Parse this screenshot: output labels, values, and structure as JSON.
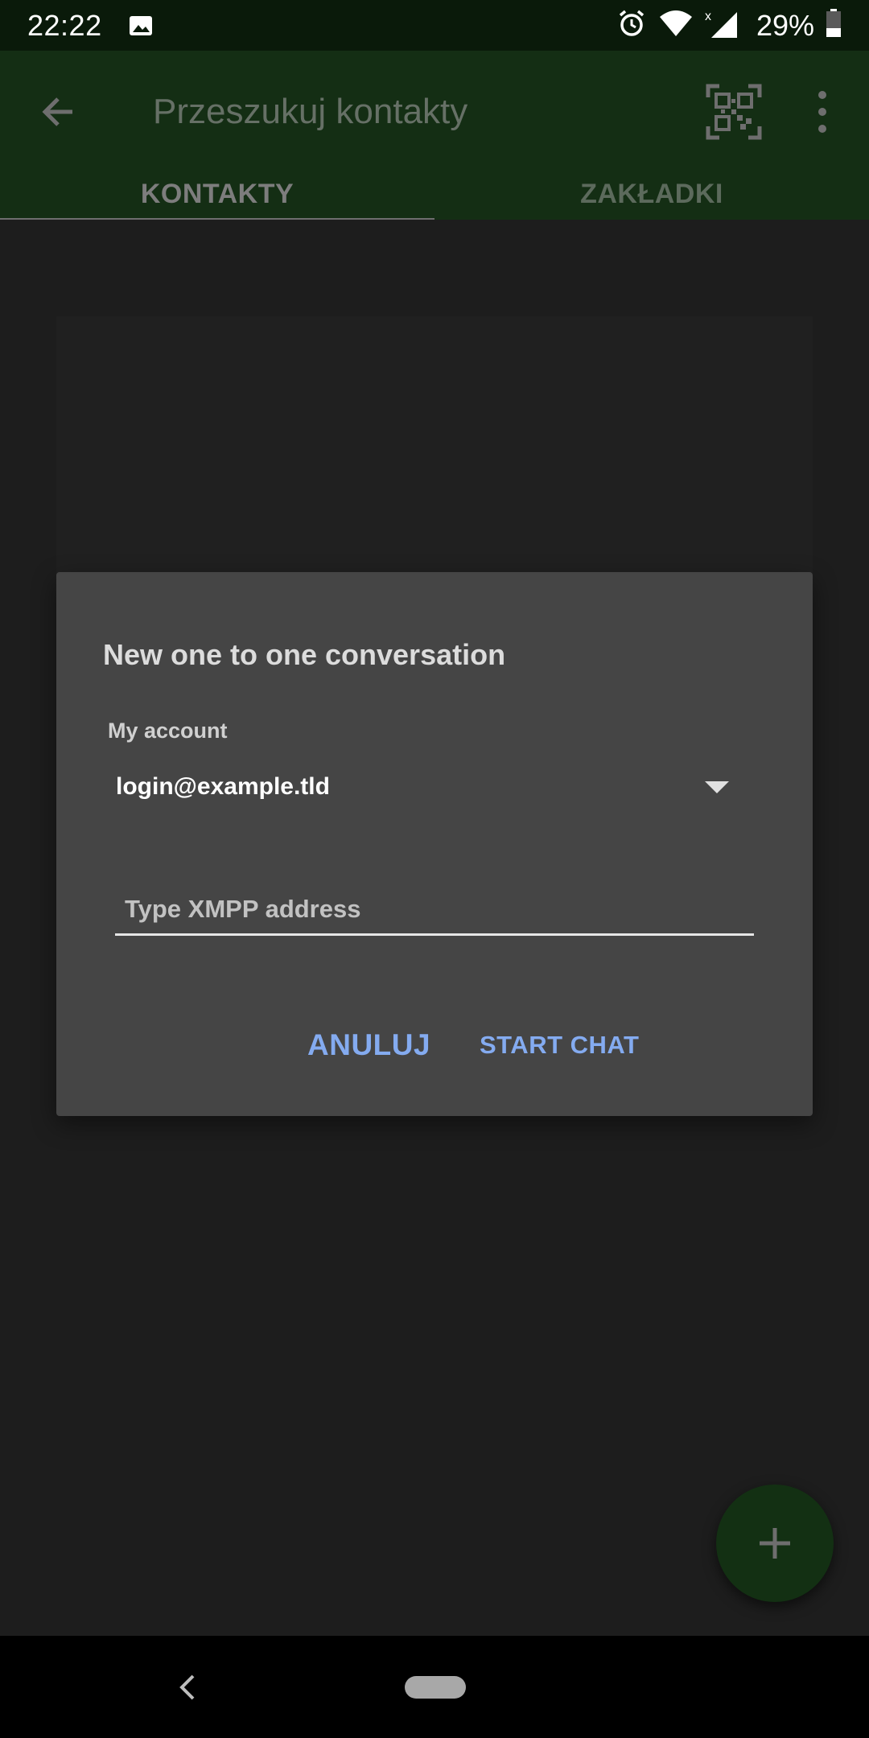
{
  "status_bar": {
    "time": "22:22",
    "battery_percent": "29%",
    "icons": [
      "image-icon",
      "alarm-icon",
      "wifi-icon",
      "signal-icon",
      "battery-icon"
    ]
  },
  "app_bar": {
    "search_placeholder": "Przeszukuj kontakty",
    "back_icon": "arrow-back-icon",
    "qr_icon": "qr-code-scan-icon",
    "menu_icon": "more-vert-icon",
    "tabs": [
      {
        "label": "KONTAKTY",
        "active": true
      },
      {
        "label": "ZAKŁADKI",
        "active": false
      }
    ]
  },
  "dialog": {
    "title": "New one to one conversation",
    "account_label": "My account",
    "account_value": "login@example.tld",
    "xmpp_placeholder": "Type XMPP address",
    "xmpp_value": "",
    "cancel_label": "ANULUJ",
    "start_label": "START CHAT"
  },
  "fab": {
    "icon": "plus-icon"
  },
  "nav_bar": {
    "back_icon": "nav-back-icon",
    "home_icon": "nav-home-pill"
  },
  "colors": {
    "app_bar": "#142e14",
    "status_bar": "#0a1a0a",
    "dialog_bg": "#454545",
    "accent_button": "#84abf0",
    "fab": "#133013"
  }
}
